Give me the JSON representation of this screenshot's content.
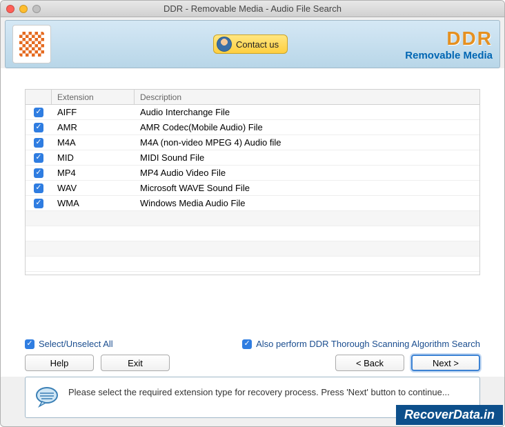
{
  "window": {
    "title": "DDR - Removable Media - Audio File Search"
  },
  "header": {
    "contact_label": "Contact us",
    "brand_main": "DDR",
    "brand_sub": "Removable Media"
  },
  "table": {
    "headers": {
      "extension": "Extension",
      "description": "Description"
    },
    "rows": [
      {
        "ext": "AIFF",
        "desc": "Audio Interchange File"
      },
      {
        "ext": "AMR",
        "desc": "AMR Codec(Mobile Audio) File"
      },
      {
        "ext": "M4A",
        "desc": "M4A (non-video MPEG 4) Audio file"
      },
      {
        "ext": "MID",
        "desc": "MIDI Sound File"
      },
      {
        "ext": "MP4",
        "desc": "MP4 Audio Video File"
      },
      {
        "ext": "WAV",
        "desc": "Microsoft WAVE Sound File"
      },
      {
        "ext": "WMA",
        "desc": "Windows Media Audio File"
      }
    ]
  },
  "options": {
    "select_all": "Select/Unselect All",
    "thorough": "Also perform DDR Thorough Scanning Algorithm Search"
  },
  "buttons": {
    "help": "Help",
    "exit": "Exit",
    "back": "< Back",
    "next": "Next >"
  },
  "info": {
    "text": "Please select the required extension type for recovery process. Press 'Next' button to continue..."
  },
  "watermark": "RecoverData.in"
}
